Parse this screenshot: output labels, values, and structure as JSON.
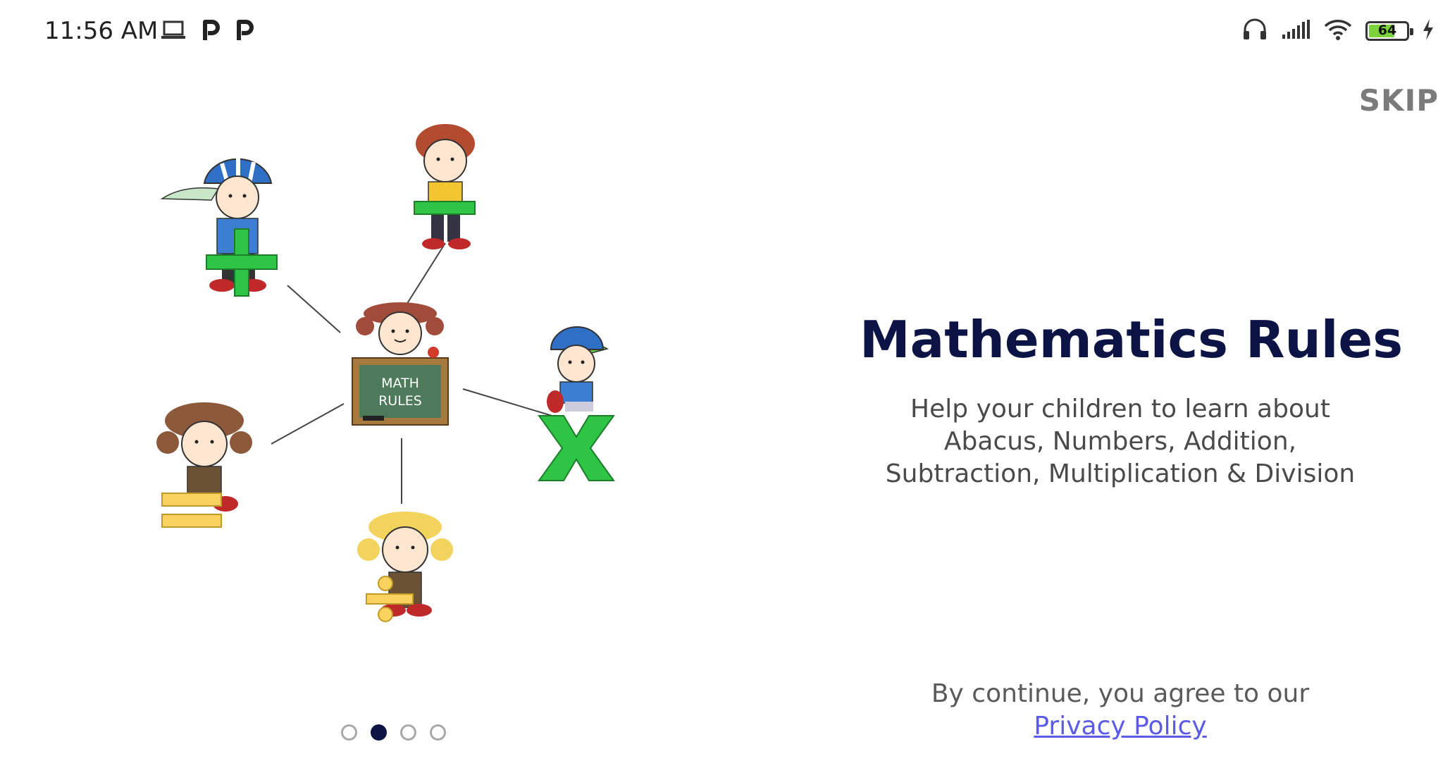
{
  "status_bar": {
    "time": "11:56 AM",
    "battery_level": "64",
    "icons_left": [
      "laptop-icon",
      "parking-app-icon",
      "parking-app-icon"
    ],
    "icons_right": [
      "headphones-icon",
      "signal-icon",
      "wifi-icon",
      "battery-icon",
      "charging-bolt-icon"
    ]
  },
  "header": {
    "skip_label": "SKIP"
  },
  "illustration": {
    "chalkboard_text_line1": "MATH",
    "chalkboard_text_line2": "RULES",
    "symbols": [
      "plus",
      "minus",
      "times",
      "equals",
      "divide"
    ],
    "colors": {
      "green": "#2ec445",
      "yellow": "#f9d25f",
      "board": "#4c7a5a",
      "frame": "#a6793f"
    }
  },
  "main": {
    "title": "Mathematics Rules",
    "subtitle_line1": "Help your children to learn about",
    "subtitle_line2": "Abacus, Numbers, Addition,",
    "subtitle_line3": "Subtraction, Multiplication & Division"
  },
  "footer": {
    "consent_text": "By continue, you agree to our",
    "privacy_link": "Privacy Policy"
  },
  "pager": {
    "page_count": 4,
    "active_index": 1
  },
  "colors": {
    "title": "#0c1446",
    "link": "#5b5be6",
    "skip": "#7b7b7b",
    "active_dot": "#0c1446"
  }
}
